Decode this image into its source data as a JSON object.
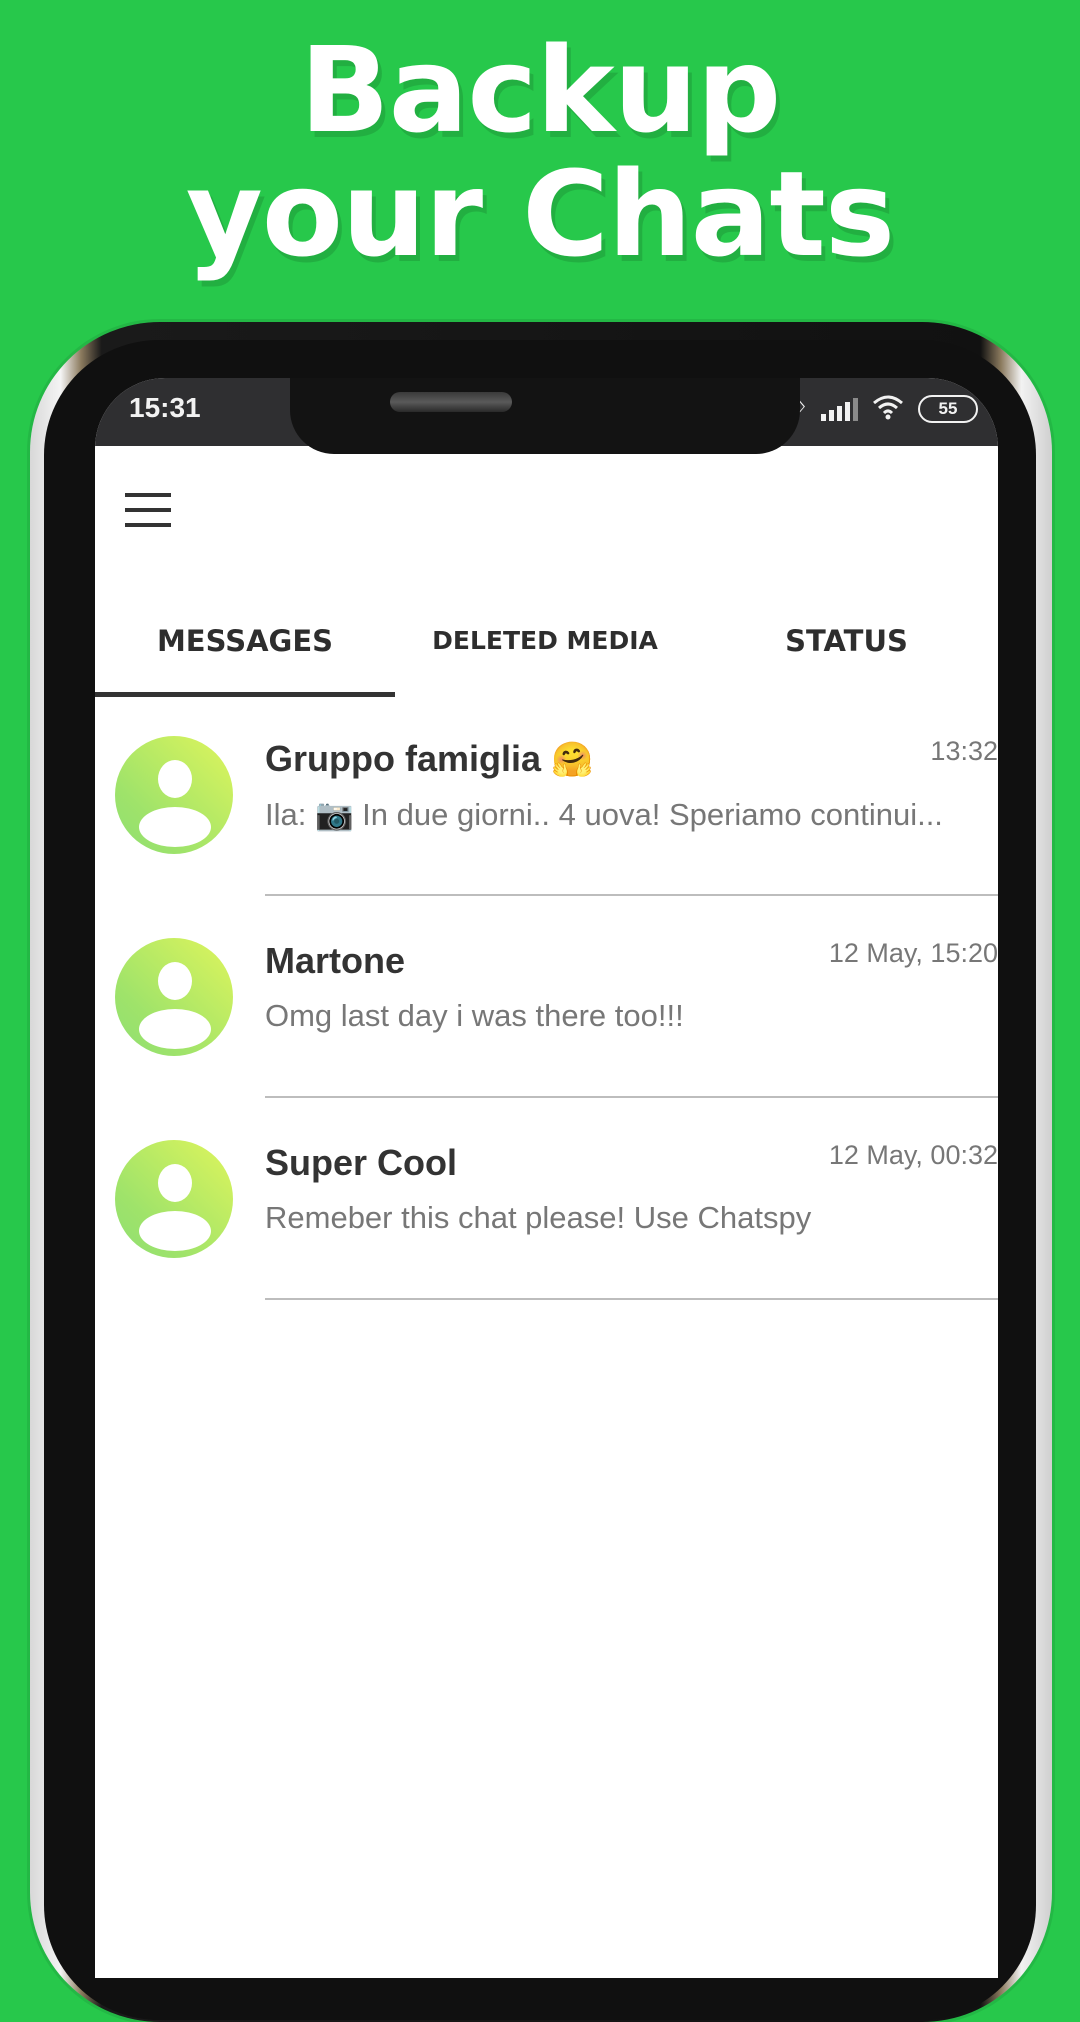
{
  "promo": {
    "headline_line1": "Backup",
    "headline_line2": "your Chats",
    "background_color": "#27c84b"
  },
  "statusbar": {
    "time": "15:31",
    "icons": [
      "bluetooth-icon",
      "signal-icon",
      "wifi-icon",
      "battery-icon"
    ],
    "battery_level": "55"
  },
  "app": {
    "menu_icon": "hamburger-menu-icon",
    "tabs": [
      {
        "label": "MESSAGES",
        "active": true
      },
      {
        "label": "DELETED MEDIA",
        "active": false
      },
      {
        "label": "STATUS",
        "active": false
      }
    ],
    "chats": [
      {
        "name": "Gruppo famiglia",
        "name_emoji": "🤗",
        "time": "13:32",
        "message": "Ila: 📷 In due giorni.. 4 uova! Speriamo continui..."
      },
      {
        "name": "Martone",
        "name_emoji": "",
        "time": "12 May, 15:20",
        "message": "Omg last day i was there too!!!"
      },
      {
        "name": "Super Cool",
        "name_emoji": "",
        "time": "12 May, 00:32",
        "message": "Remeber this chat please! Use Chatspy"
      }
    ]
  }
}
